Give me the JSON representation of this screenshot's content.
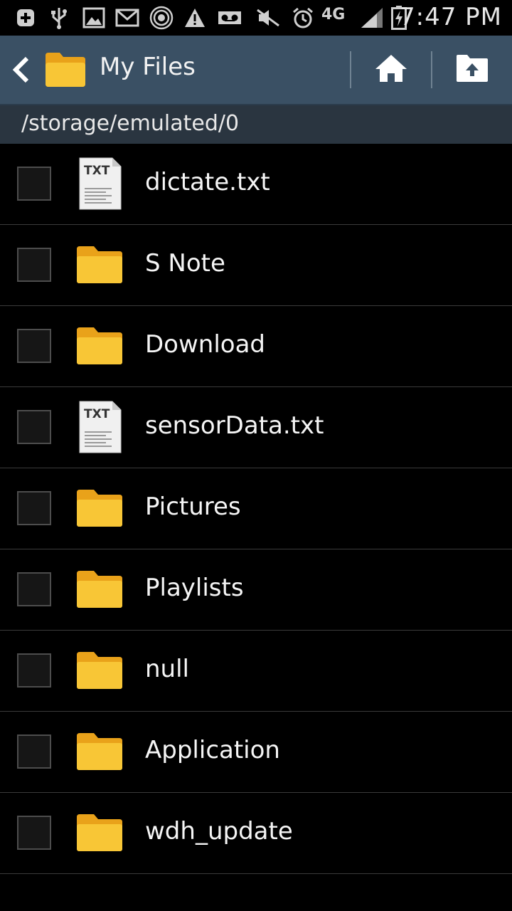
{
  "status_bar": {
    "time": "7:47 PM",
    "network": "4G",
    "icons": [
      "add-icon",
      "usb-icon",
      "image-icon",
      "gmail-icon",
      "nfc-icon",
      "warning-icon",
      "voicemail-icon",
      "mute-icon",
      "alarm-icon",
      "network-4g-icon",
      "signal-icon",
      "battery-icon"
    ]
  },
  "action_bar": {
    "title": "My Files",
    "icons": {
      "back": "back-icon",
      "app": "folder-icon",
      "home": "home-icon",
      "upload": "upload-folder-icon"
    }
  },
  "path": "/storage/emulated/0",
  "files": [
    {
      "name": "dictate.txt",
      "type": "txt"
    },
    {
      "name": "S Note",
      "type": "folder"
    },
    {
      "name": "Download",
      "type": "folder"
    },
    {
      "name": "sensorData.txt",
      "type": "txt"
    },
    {
      "name": "Pictures",
      "type": "folder"
    },
    {
      "name": "Playlists",
      "type": "folder"
    },
    {
      "name": "null",
      "type": "folder"
    },
    {
      "name": "Application",
      "type": "folder"
    },
    {
      "name": "wdh_update",
      "type": "folder"
    }
  ],
  "txt_badge": "TXT",
  "colors": {
    "action_bar": "#3a5064",
    "path_bar": "#2a3540",
    "folder": "#f5c232",
    "background": "#000000"
  }
}
